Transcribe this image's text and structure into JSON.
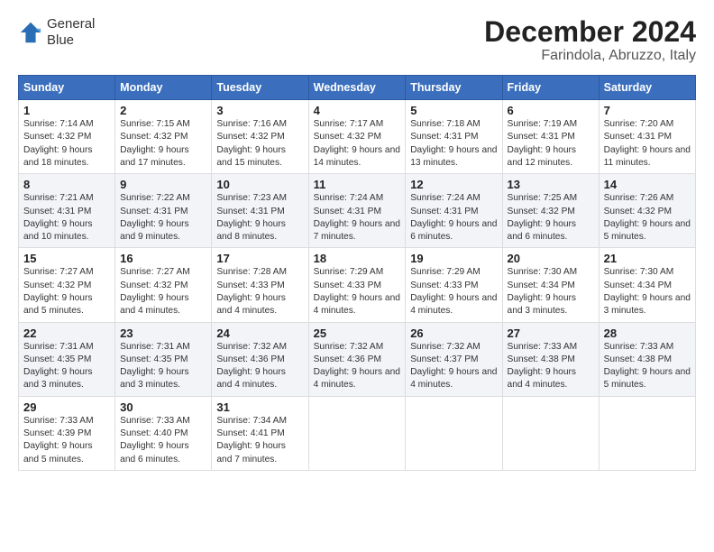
{
  "header": {
    "logo_line1": "General",
    "logo_line2": "Blue",
    "month": "December 2024",
    "location": "Farindola, Abruzzo, Italy"
  },
  "days_of_week": [
    "Sunday",
    "Monday",
    "Tuesday",
    "Wednesday",
    "Thursday",
    "Friday",
    "Saturday"
  ],
  "weeks": [
    [
      {
        "day": "1",
        "sunrise": "7:14 AM",
        "sunset": "4:32 PM",
        "daylight": "9 hours and 18 minutes."
      },
      {
        "day": "2",
        "sunrise": "7:15 AM",
        "sunset": "4:32 PM",
        "daylight": "9 hours and 17 minutes."
      },
      {
        "day": "3",
        "sunrise": "7:16 AM",
        "sunset": "4:32 PM",
        "daylight": "9 hours and 15 minutes."
      },
      {
        "day": "4",
        "sunrise": "7:17 AM",
        "sunset": "4:32 PM",
        "daylight": "9 hours and 14 minutes."
      },
      {
        "day": "5",
        "sunrise": "7:18 AM",
        "sunset": "4:31 PM",
        "daylight": "9 hours and 13 minutes."
      },
      {
        "day": "6",
        "sunrise": "7:19 AM",
        "sunset": "4:31 PM",
        "daylight": "9 hours and 12 minutes."
      },
      {
        "day": "7",
        "sunrise": "7:20 AM",
        "sunset": "4:31 PM",
        "daylight": "9 hours and 11 minutes."
      }
    ],
    [
      {
        "day": "8",
        "sunrise": "7:21 AM",
        "sunset": "4:31 PM",
        "daylight": "9 hours and 10 minutes."
      },
      {
        "day": "9",
        "sunrise": "7:22 AM",
        "sunset": "4:31 PM",
        "daylight": "9 hours and 9 minutes."
      },
      {
        "day": "10",
        "sunrise": "7:23 AM",
        "sunset": "4:31 PM",
        "daylight": "9 hours and 8 minutes."
      },
      {
        "day": "11",
        "sunrise": "7:24 AM",
        "sunset": "4:31 PM",
        "daylight": "9 hours and 7 minutes."
      },
      {
        "day": "12",
        "sunrise": "7:24 AM",
        "sunset": "4:31 PM",
        "daylight": "9 hours and 6 minutes."
      },
      {
        "day": "13",
        "sunrise": "7:25 AM",
        "sunset": "4:32 PM",
        "daylight": "9 hours and 6 minutes."
      },
      {
        "day": "14",
        "sunrise": "7:26 AM",
        "sunset": "4:32 PM",
        "daylight": "9 hours and 5 minutes."
      }
    ],
    [
      {
        "day": "15",
        "sunrise": "7:27 AM",
        "sunset": "4:32 PM",
        "daylight": "9 hours and 5 minutes."
      },
      {
        "day": "16",
        "sunrise": "7:27 AM",
        "sunset": "4:32 PM",
        "daylight": "9 hours and 4 minutes."
      },
      {
        "day": "17",
        "sunrise": "7:28 AM",
        "sunset": "4:33 PM",
        "daylight": "9 hours and 4 minutes."
      },
      {
        "day": "18",
        "sunrise": "7:29 AM",
        "sunset": "4:33 PM",
        "daylight": "9 hours and 4 minutes."
      },
      {
        "day": "19",
        "sunrise": "7:29 AM",
        "sunset": "4:33 PM",
        "daylight": "9 hours and 4 minutes."
      },
      {
        "day": "20",
        "sunrise": "7:30 AM",
        "sunset": "4:34 PM",
        "daylight": "9 hours and 3 minutes."
      },
      {
        "day": "21",
        "sunrise": "7:30 AM",
        "sunset": "4:34 PM",
        "daylight": "9 hours and 3 minutes."
      }
    ],
    [
      {
        "day": "22",
        "sunrise": "7:31 AM",
        "sunset": "4:35 PM",
        "daylight": "9 hours and 3 minutes."
      },
      {
        "day": "23",
        "sunrise": "7:31 AM",
        "sunset": "4:35 PM",
        "daylight": "9 hours and 3 minutes."
      },
      {
        "day": "24",
        "sunrise": "7:32 AM",
        "sunset": "4:36 PM",
        "daylight": "9 hours and 4 minutes."
      },
      {
        "day": "25",
        "sunrise": "7:32 AM",
        "sunset": "4:36 PM",
        "daylight": "9 hours and 4 minutes."
      },
      {
        "day": "26",
        "sunrise": "7:32 AM",
        "sunset": "4:37 PM",
        "daylight": "9 hours and 4 minutes."
      },
      {
        "day": "27",
        "sunrise": "7:33 AM",
        "sunset": "4:38 PM",
        "daylight": "9 hours and 4 minutes."
      },
      {
        "day": "28",
        "sunrise": "7:33 AM",
        "sunset": "4:38 PM",
        "daylight": "9 hours and 5 minutes."
      }
    ],
    [
      {
        "day": "29",
        "sunrise": "7:33 AM",
        "sunset": "4:39 PM",
        "daylight": "9 hours and 5 minutes."
      },
      {
        "day": "30",
        "sunrise": "7:33 AM",
        "sunset": "4:40 PM",
        "daylight": "9 hours and 6 minutes."
      },
      {
        "day": "31",
        "sunrise": "7:34 AM",
        "sunset": "4:41 PM",
        "daylight": "9 hours and 7 minutes."
      },
      null,
      null,
      null,
      null
    ]
  ]
}
